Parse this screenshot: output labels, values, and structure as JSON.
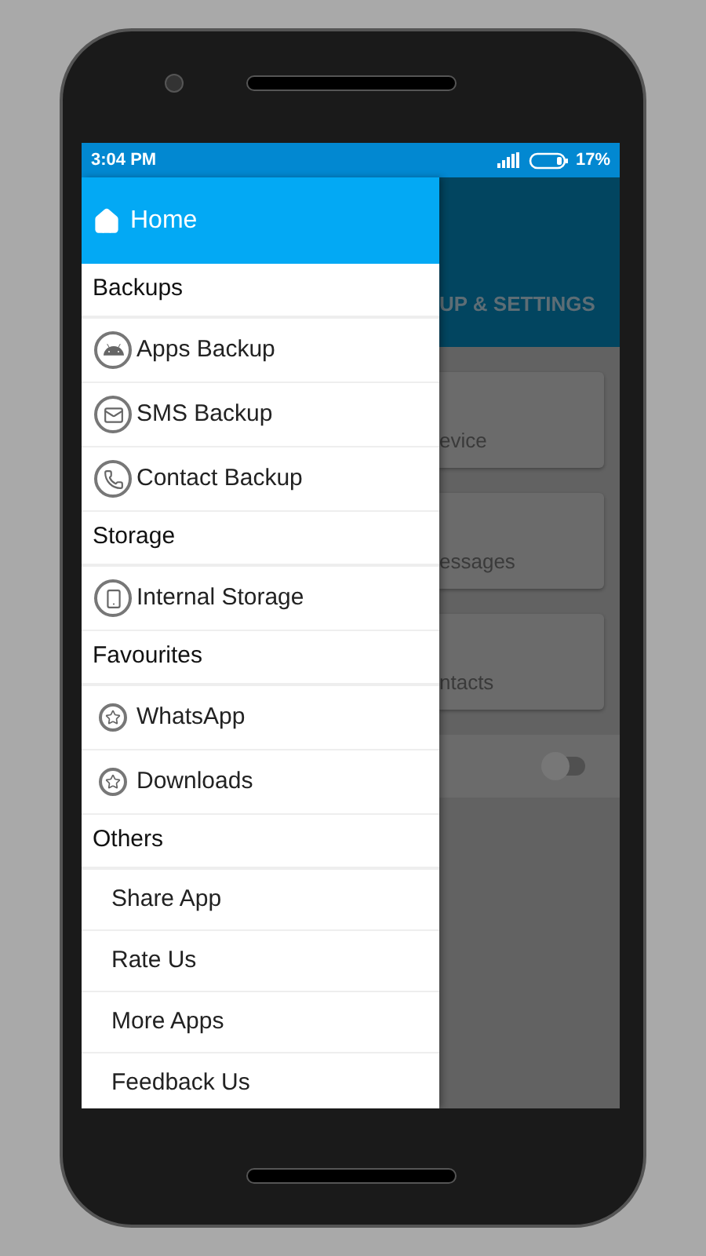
{
  "status_bar": {
    "time": "3:04 PM",
    "battery": "17%"
  },
  "background": {
    "app_bar_title": "UP & SETTINGS",
    "cards": [
      {
        "label": "evice"
      },
      {
        "label": "essages"
      },
      {
        "label": "ntacts"
      }
    ],
    "switch": {
      "on": false
    }
  },
  "drawer": {
    "header": {
      "label": "Home"
    },
    "sections": [
      {
        "title": "Backups",
        "items": [
          {
            "label": "Apps Backup",
            "kind": "android"
          },
          {
            "label": "SMS Backup",
            "kind": "mail"
          },
          {
            "label": "Contact Backup",
            "kind": "phone"
          }
        ]
      },
      {
        "title": "Storage",
        "items": [
          {
            "label": "Internal Storage",
            "kind": "device"
          }
        ]
      },
      {
        "title": "Favourites",
        "items": [
          {
            "label": "WhatsApp",
            "kind": "star"
          },
          {
            "label": "Downloads",
            "kind": "star"
          }
        ]
      },
      {
        "title": "Others",
        "items": [
          {
            "label": "Share App",
            "kind": "plain"
          },
          {
            "label": "Rate Us",
            "kind": "plain"
          },
          {
            "label": "More Apps",
            "kind": "plain"
          },
          {
            "label": "Feedback Us",
            "kind": "plain"
          }
        ]
      }
    ]
  }
}
